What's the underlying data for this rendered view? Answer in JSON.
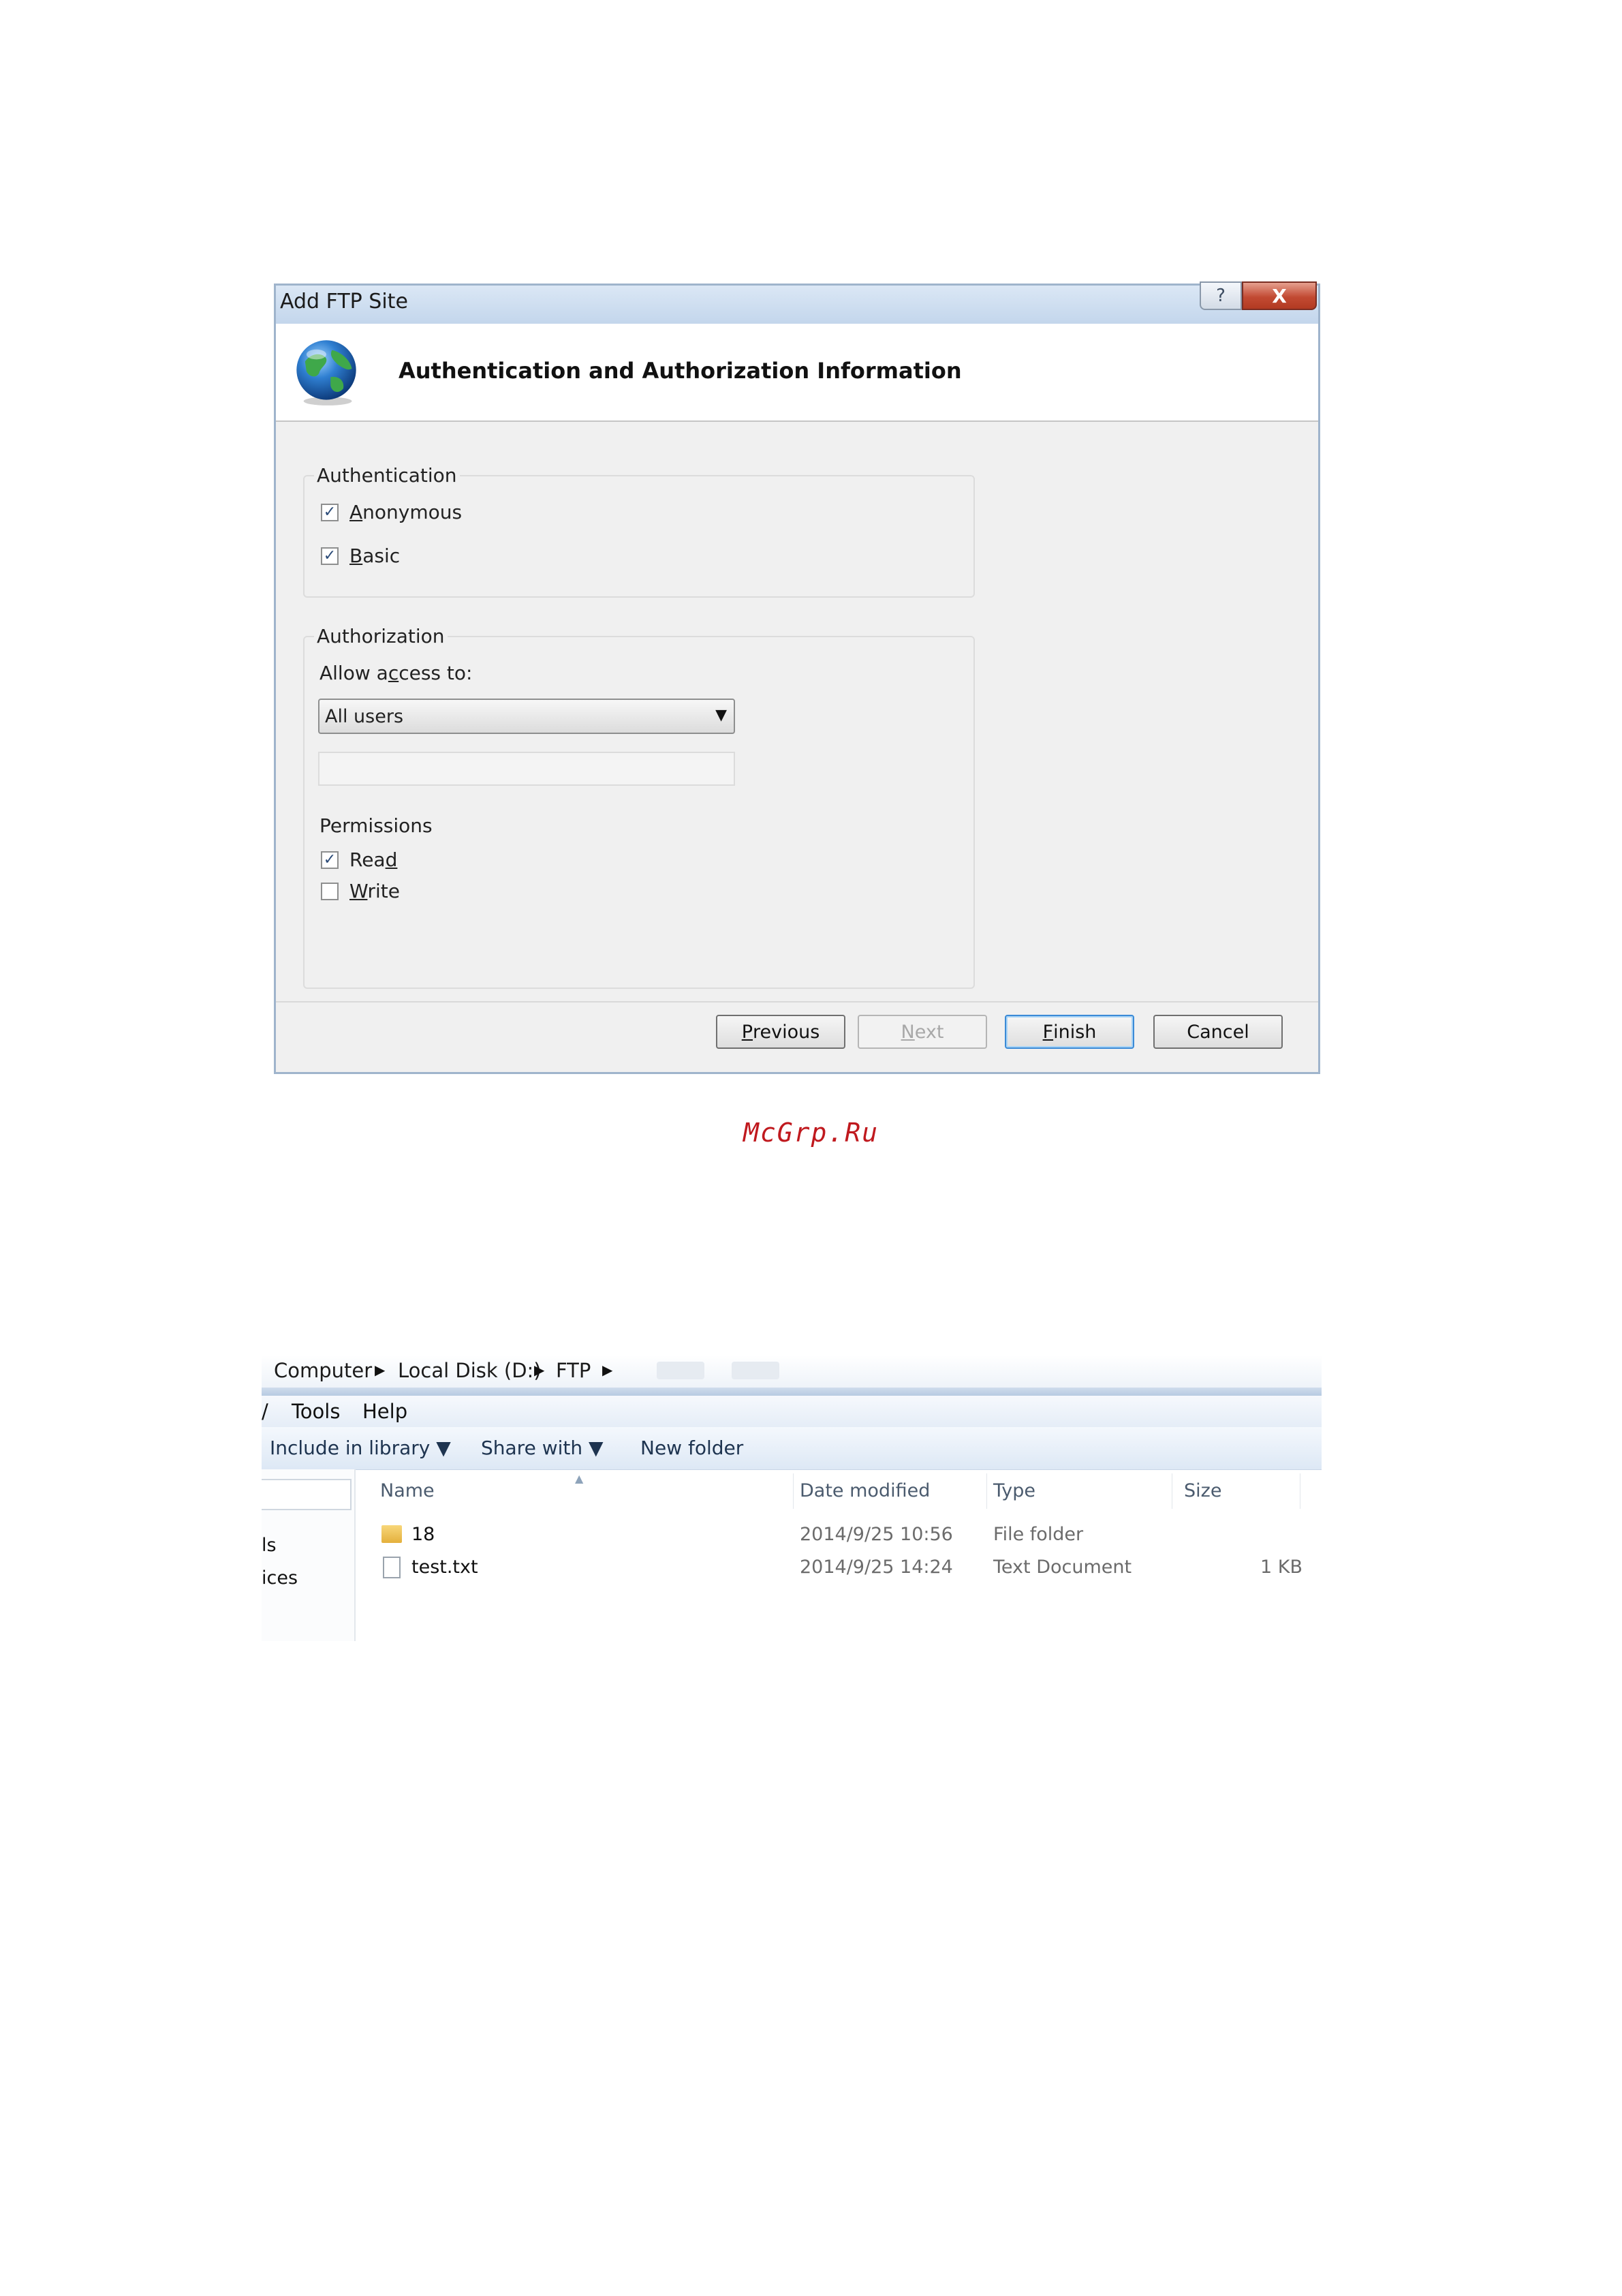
{
  "dialog": {
    "title": "Add FTP Site",
    "help_glyph": "?",
    "close_glyph": "X",
    "header_title": "Authentication and Authorization Information",
    "authentication": {
      "label": "Authentication",
      "anonymous": {
        "accel": "A",
        "rest": "nonymous",
        "checked": true
      },
      "basic": {
        "accel": "B",
        "rest": "asic",
        "checked": true
      }
    },
    "authorization": {
      "label": "Authorization",
      "allow_pre": "Allow a",
      "allow_accel": "c",
      "allow_post": "cess to:",
      "selected": "All users",
      "user_field_value": ""
    },
    "permissions": {
      "label": "Permissions",
      "read": {
        "pre": "Rea",
        "accel": "d",
        "checked": true
      },
      "write": {
        "accel": "W",
        "rest": "rite",
        "checked": false
      }
    },
    "buttons": {
      "previous": {
        "accel": "P",
        "rest": "revious"
      },
      "next": {
        "accel": "N",
        "rest": "ext"
      },
      "finish": {
        "accel": "F",
        "rest": "inish"
      },
      "cancel": "Cancel"
    },
    "check_glyph": "✓"
  },
  "watermark": "McGrp.Ru",
  "explorer": {
    "breadcrumb": [
      "Computer",
      "Local Disk (D:)",
      "FTP"
    ],
    "breadcrumb_sep": "▶",
    "menu_cut": "/",
    "menu": [
      "Tools",
      "Help"
    ],
    "toolbar": [
      "Include in library ▼",
      "Share with ▼",
      "New folder"
    ],
    "nav_items": [
      "ls",
      "ices"
    ],
    "columns": [
      "Name",
      "Date modified",
      "Type",
      "Size"
    ],
    "sort_glyph": "▲",
    "files": [
      {
        "name": "18",
        "date": "2014/9/25 10:56",
        "type": "File folder",
        "size": "",
        "icon": "folder-icon"
      },
      {
        "name": "test.txt",
        "date": "2014/9/25 14:24",
        "type": "Text Document",
        "size": "1 KB",
        "icon": "text-file-icon"
      }
    ]
  }
}
